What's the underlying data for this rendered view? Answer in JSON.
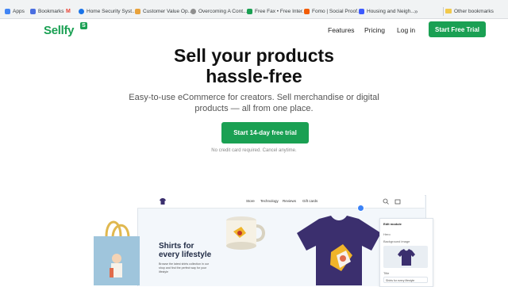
{
  "bookmarks": {
    "items": [
      {
        "label": "Apps",
        "color": "#4285f4"
      },
      {
        "label": "Bookmarks",
        "color": "#4a6ee0"
      },
      {
        "label": "M",
        "color": "#ea4335"
      },
      {
        "label": "Home Security Syst...",
        "color": "#1a73e8"
      },
      {
        "label": "Customer Value Op...",
        "color": "#e8a23c"
      },
      {
        "label": "Overcoming A Cont...",
        "color": "#8e8e8e"
      },
      {
        "label": "Free Fax • Free Inter...",
        "color": "#1aa053"
      },
      {
        "label": "Fomo | Social Proof...",
        "color": "#f25c05"
      },
      {
        "label": "Housing and Neigh...",
        "color": "#3d5afe"
      }
    ],
    "other": "Other bookmarks"
  },
  "nav": {
    "logo": "Sellfy",
    "logo_badge": "S",
    "links": [
      "Features",
      "Pricing",
      "Log in"
    ],
    "cta": "Start Free Trial"
  },
  "hero": {
    "title_line1": "Sell your products",
    "title_line2": "hassle-free",
    "subtitle_line1": "Easy-to-use eCommerce for creators. Sell merchandise or digital",
    "subtitle_line2": "products — all from one place.",
    "cta": "Start 14-day free trial",
    "note": "No credit card required. Cancel anytime."
  },
  "preview": {
    "nav_items": [
      "Store",
      "Technology",
      "Reviews",
      "Gift cards"
    ],
    "headline_line1": "Shirts for",
    "headline_line2": "every lifestyle",
    "body": "Browse the latest shirts collection in our shop and find the perfect way for your lifestyle",
    "panel_title": "Edit module",
    "panel_items": [
      "Hero",
      "Background image",
      "Title",
      "Shirts for every lifestyle"
    ]
  },
  "colors": {
    "brand": "#1aa053",
    "tshirt": "#3b2f6e",
    "tote": "#9fc5dc"
  }
}
